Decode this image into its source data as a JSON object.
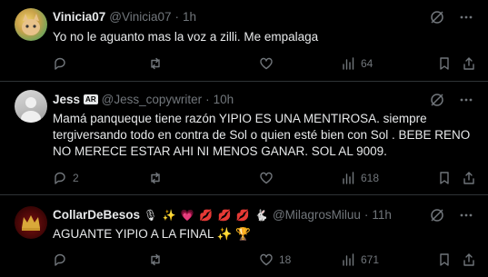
{
  "tweets": [
    {
      "name": "Vinicia07",
      "handle": "@Vinicia07",
      "time": "1h",
      "text": "Yo no le aguanto mas la voz a zilli. Me empalaga",
      "metrics": {
        "replies": "",
        "reposts": "",
        "likes": "",
        "views": "64"
      }
    },
    {
      "name": "Jess",
      "badge": "AR",
      "handle": "@Jess_copywriter",
      "time": "10h",
      "text": "Mamá panqueque tiene razón YIPIO ES UNA MENTIROSA. siempre\ntergiversando todo en contra de Sol o quien esté bien con Sol . BEBE RENO\nNO MERECE ESTAR AHI NI MENOS GANAR. SOL AL 9009.",
      "metrics": {
        "replies": "2",
        "reposts": "",
        "likes": "",
        "views": "618"
      }
    },
    {
      "name": "CollarDeBesos",
      "name_emojis": "🎙 ✨ 💗 💋 💋 💋 🐇",
      "handle": "@MilagrosMiluu",
      "time": "11h",
      "text": "AGUANTE YIPIO A LA FINAL ✨ 🏆",
      "metrics": {
        "replies": "",
        "reposts": "",
        "likes": "18",
        "views": "671"
      }
    }
  ],
  "dot": "·",
  "colors": {
    "background": "#000000",
    "text": "#e7e9ea",
    "muted": "#71767b",
    "divider": "#2f3336"
  }
}
